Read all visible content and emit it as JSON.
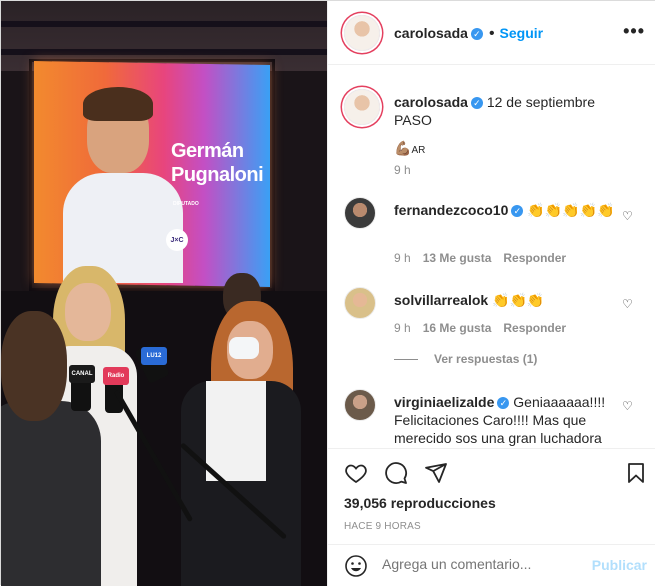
{
  "post": {
    "media": {
      "screen_name_line1": "Germán",
      "screen_name_line2": "Pugnaloni",
      "screen_role": "DIPUTADO",
      "screen_logo": "J×C",
      "mic_flag_1": "CANAL",
      "mic_flag_2": "Radio",
      "mic_flag_3": "LU12"
    },
    "header": {
      "username": "carolosada",
      "follow_label": "Seguir",
      "dot": "•",
      "more_icon": "more-options-icon"
    },
    "caption": {
      "username": "carolosada",
      "text": "12 de septiembre PASO",
      "emoji_line": "💪🏽",
      "emoji_suffix": "AR",
      "time": "9 h"
    },
    "comments": [
      {
        "username": "fernandezcoco10",
        "text": "👏👏👏👏👏",
        "time": "9 h",
        "likes": "13 Me gusta",
        "reply": "Responder"
      },
      {
        "username": "solvillarrealok",
        "text": "👏👏👏",
        "time": "9 h",
        "likes": "16 Me gusta",
        "reply": "Responder"
      },
      {
        "username": "virginiaelizalde",
        "text": "Geniaaaaaa!!!! Felicitaciones Caro!!!! Mas que merecido sos una gran luchadora"
      }
    ],
    "view_replies": "Ver respuestas (1)",
    "stats": {
      "views": "39,056 reproducciones",
      "time_ago": "HACE 9 HORAS"
    },
    "comment_box": {
      "placeholder": "Agrega un comentario...",
      "publish_label": "Publicar"
    },
    "colors": {
      "accent": "#0095f6",
      "verified": "#3897f0",
      "muted": "#8e8e8e",
      "publish_disabled": "#b2dffc"
    }
  }
}
